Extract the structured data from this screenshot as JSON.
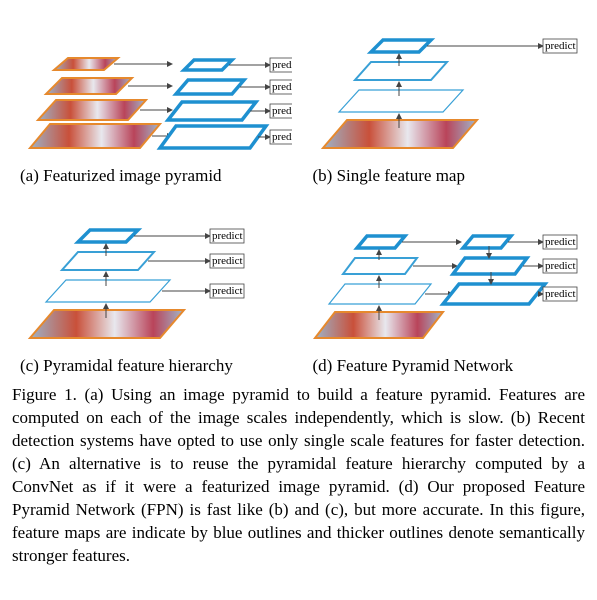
{
  "figure_number": "Figure 1.",
  "predict_label": "predict",
  "panels": {
    "a": {
      "caption": "(a) Featurized image pyramid"
    },
    "b": {
      "caption": "(b) Single feature map"
    },
    "c": {
      "caption": "(c) Pyramidal feature hierarchy"
    },
    "d": {
      "caption": "(d) Feature Pyramid Network"
    }
  },
  "caption_text": "(a) Using an image pyramid to build a feature pyramid. Features are computed on each of the image scales independently, which is slow. (b) Recent detection systems have opted to use only single scale features for faster detection. (c) An alternative is to reuse the pyramidal feature hierarchy computed by a ConvNet as if it were a featurized image pyramid. (d) Our proposed Feature Pyramid Network (FPN) is fast like (b) and (c), but more accurate. In this figure, feature maps are indicate by blue outlines and thicker outlines denote semantically stronger features.",
  "colors": {
    "thin_blue": "#39a0d6",
    "thick_blue": "#1e90d0",
    "orange": "#e6892d",
    "arrow": "#444"
  },
  "chart_data": {
    "type": "diagram",
    "description": "Four architecture schematics comparing multi-scale feature strategies for object detection.",
    "panels": [
      {
        "id": "a",
        "name": "Featurized image pyramid",
        "left_stack": "multi-scale input images (4 levels)",
        "right_stack": "feature maps (4 levels, all thick/strong)",
        "arrows": "horizontal from each image level to its feature map; each feature map → predict box",
        "predict_count": 4
      },
      {
        "id": "b",
        "name": "Single feature map",
        "left_stack": "single input image + 3 conv levels on top (thin → thick)",
        "vertical_arrows": "upward between levels",
        "arrows": "only topmost level → predict",
        "predict_count": 1
      },
      {
        "id": "c",
        "name": "Pyramidal feature hierarchy",
        "left_stack": "single input image + 3 conv levels (thin → thick)",
        "vertical_arrows": "upward between levels",
        "arrows": "each of 3 conv levels → predict",
        "predict_count": 3
      },
      {
        "id": "d",
        "name": "Feature Pyramid Network",
        "left_stack": "single input image + 3 conv levels (thin → thick), upward arrows",
        "right_stack": "3 feature maps (all thick/strong), downward arrows between them (top-down pathway)",
        "lateral": "horizontal arrows from each left level to corresponding right level",
        "arrows": "each right-stack level → predict",
        "predict_count": 3
      }
    ],
    "legend": {
      "orange_outline": "input image",
      "blue_outline": "feature map",
      "thickness": "thicker outline = semantically stronger features"
    }
  }
}
